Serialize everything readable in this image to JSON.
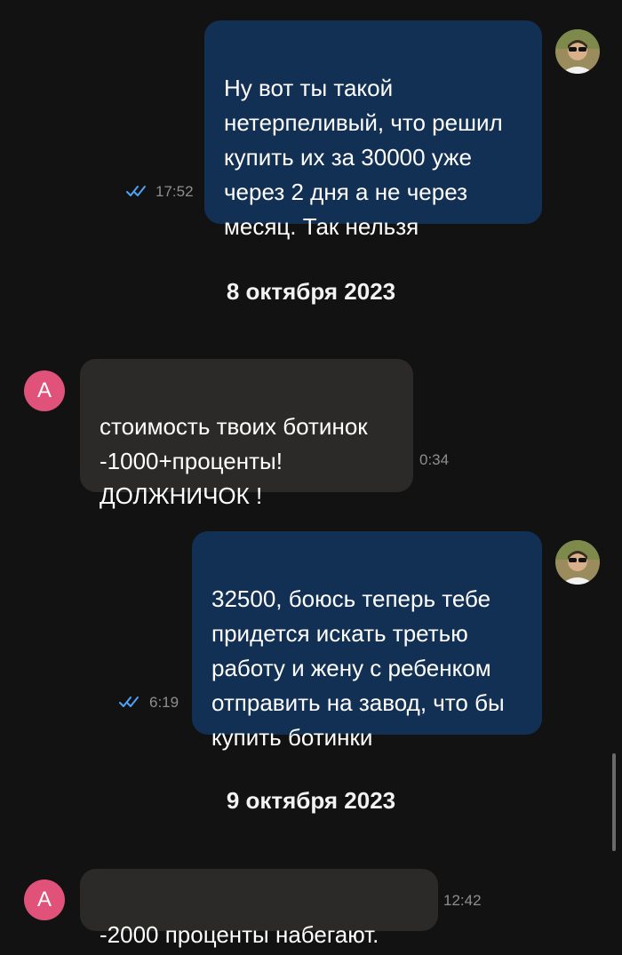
{
  "messages": [
    {
      "direction": "outgoing",
      "text": "Ну вот ты такой\nнетерпеливый, что решил\nкупить их за 30000 уже\nчерез 2 дня а не через\nмесяц. Так нельзя",
      "time": "17:52",
      "read": true
    },
    {
      "direction": "incoming",
      "sender_initial": "А",
      "text": "стоимость твоих ботинок\n-1000+проценты!\nДОЛЖНИЧОК !",
      "time": "0:34"
    },
    {
      "direction": "outgoing",
      "text": "32500, боюсь теперь тебе\nпридется искать третью\nработу и жену с ребенком\nотправить на завод, что бы\nкупить ботинки",
      "time": "6:19",
      "read": true
    },
    {
      "direction": "incoming",
      "sender_initial": "А",
      "text": "-2000  проценты набегают.",
      "time": "12:42"
    }
  ],
  "dates": [
    "8 октября 2023",
    "9 октября 2023"
  ],
  "colors": {
    "background": "#121212",
    "outgoing_bubble": "#123054",
    "incoming_bubble": "#2b2a28",
    "avatar_letter_bg": "#e0527a",
    "read_check": "#4fa3f7",
    "timestamp": "#8e8e8e"
  },
  "icons": {
    "read_receipt": "double-check-icon",
    "own_avatar": "user-photo-avatar"
  }
}
